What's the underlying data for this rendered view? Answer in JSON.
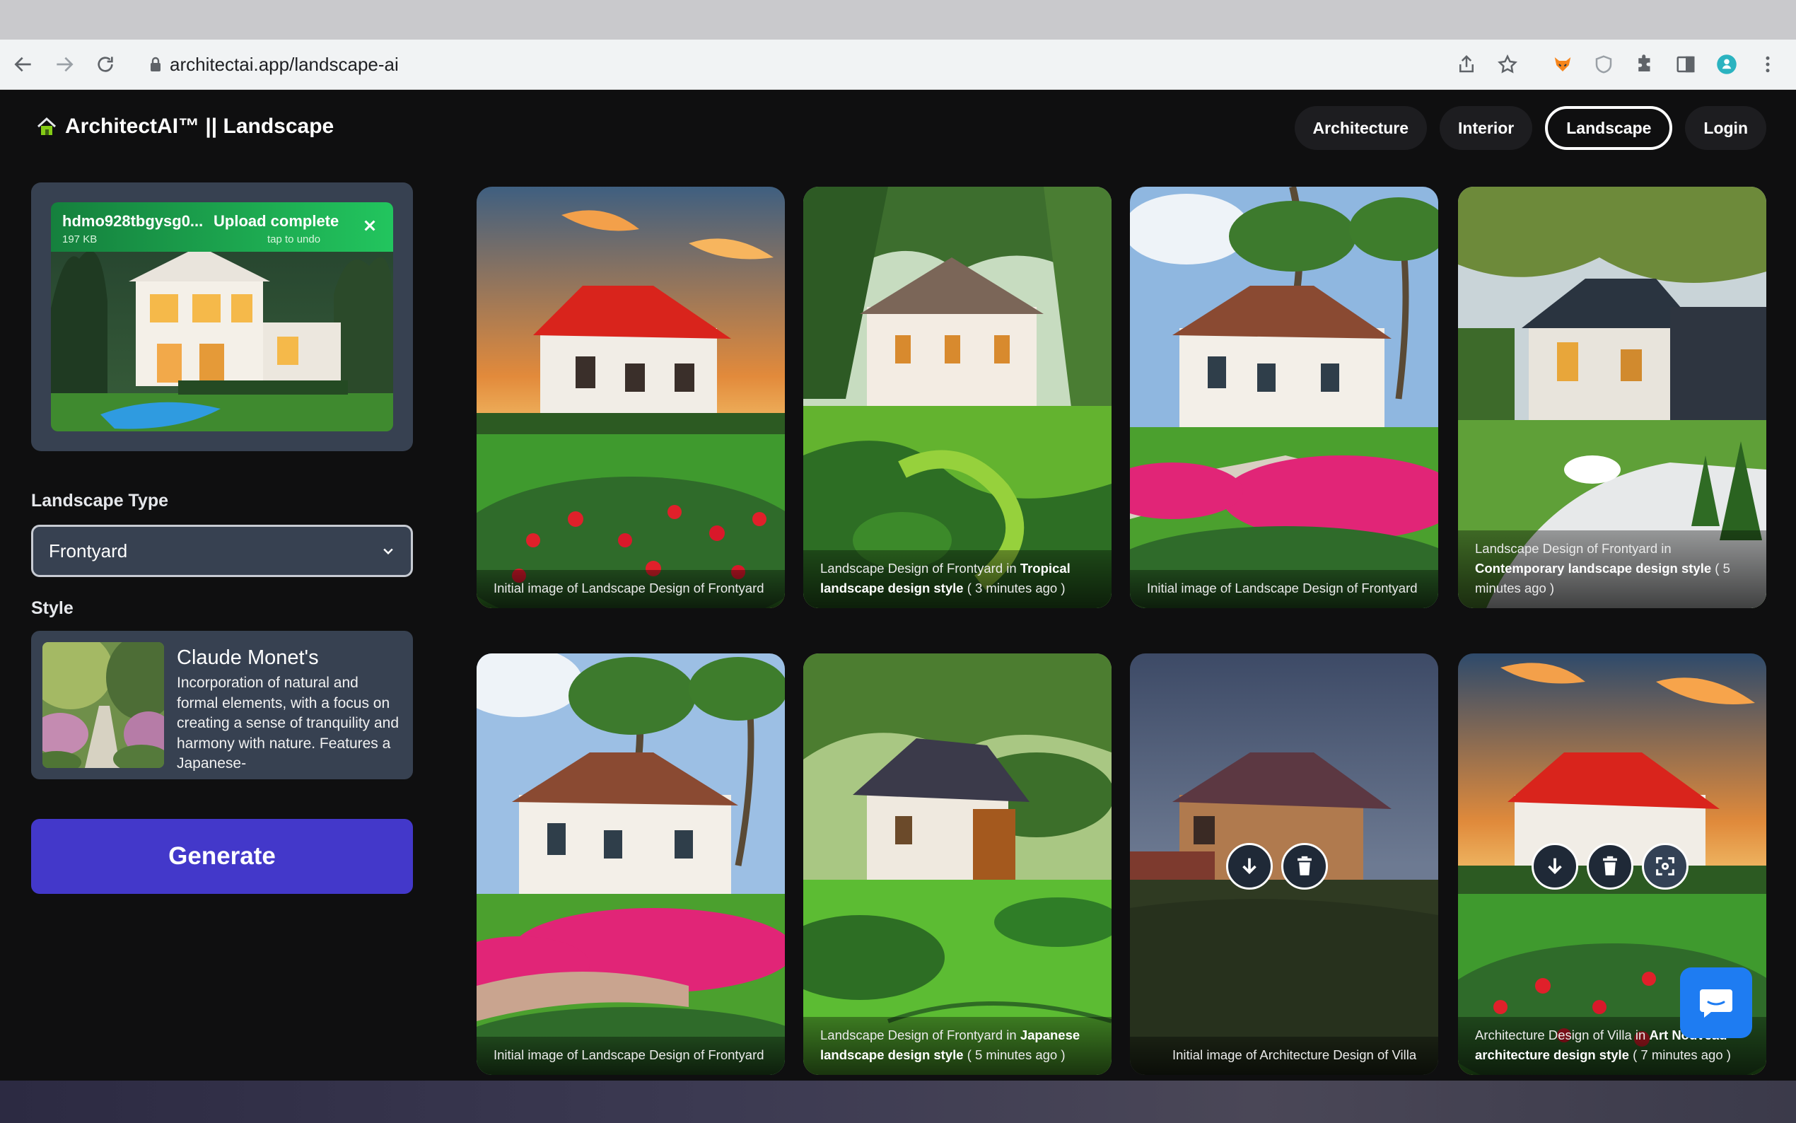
{
  "browser": {
    "url": "architectai.app/landscape-ai"
  },
  "app": {
    "logo_text": "ArchitectAI™ || Landscape"
  },
  "nav": [
    {
      "label": "Architecture",
      "active": false
    },
    {
      "label": "Interior",
      "active": false
    },
    {
      "label": "Landscape",
      "active": true
    },
    {
      "label": "Login",
      "active": false
    }
  ],
  "upload": {
    "filename": "hdmo928tbgysg0...",
    "size": "197 KB",
    "status": "Upload complete",
    "undo": "tap to undo"
  },
  "form": {
    "landscape_type_label": "Landscape Type",
    "landscape_type_value": "Frontyard",
    "style_label": "Style",
    "style_name": "Claude Monet's",
    "style_description": "Incorporation of natural and formal elements, with a focus on creating a sense of tranquility and harmony with nature. Features a Japanese-",
    "generate_label": "Generate"
  },
  "gallery": [
    {
      "caption": "Initial image of Landscape Design of Frontyard"
    },
    {
      "caption_pre": "Landscape Design of Frontyard in ",
      "caption_bold": "Tropical landscape design style",
      "caption_post": " ( 3 minutes ago )"
    },
    {
      "caption": "Initial image of Landscape Design of Frontyard"
    },
    {
      "caption_pre": "Landscape Design of Frontyard in ",
      "caption_bold": "Contemporary landscape design style",
      "caption_post": " ( 5 minutes ago )"
    },
    {
      "caption": "Initial image of Landscape Design of Frontyard"
    },
    {
      "caption_pre": "Landscape Design of Frontyard in ",
      "caption_bold": "Japanese landscape design style",
      "caption_post": " ( 5 minutes ago )"
    },
    {
      "caption": "Initial image of Architecture Design of Villa"
    },
    {
      "caption_pre": "Architecture Design of Villa in ",
      "caption_bold": "Art Nouveau architecture design style",
      "caption_post": " ( 7 minutes ago )"
    }
  ],
  "colors": {
    "accent": "#4338ca",
    "upload_green": "#22c55e",
    "card_bg": "#374151",
    "chat_blue": "#1e7cf2"
  }
}
